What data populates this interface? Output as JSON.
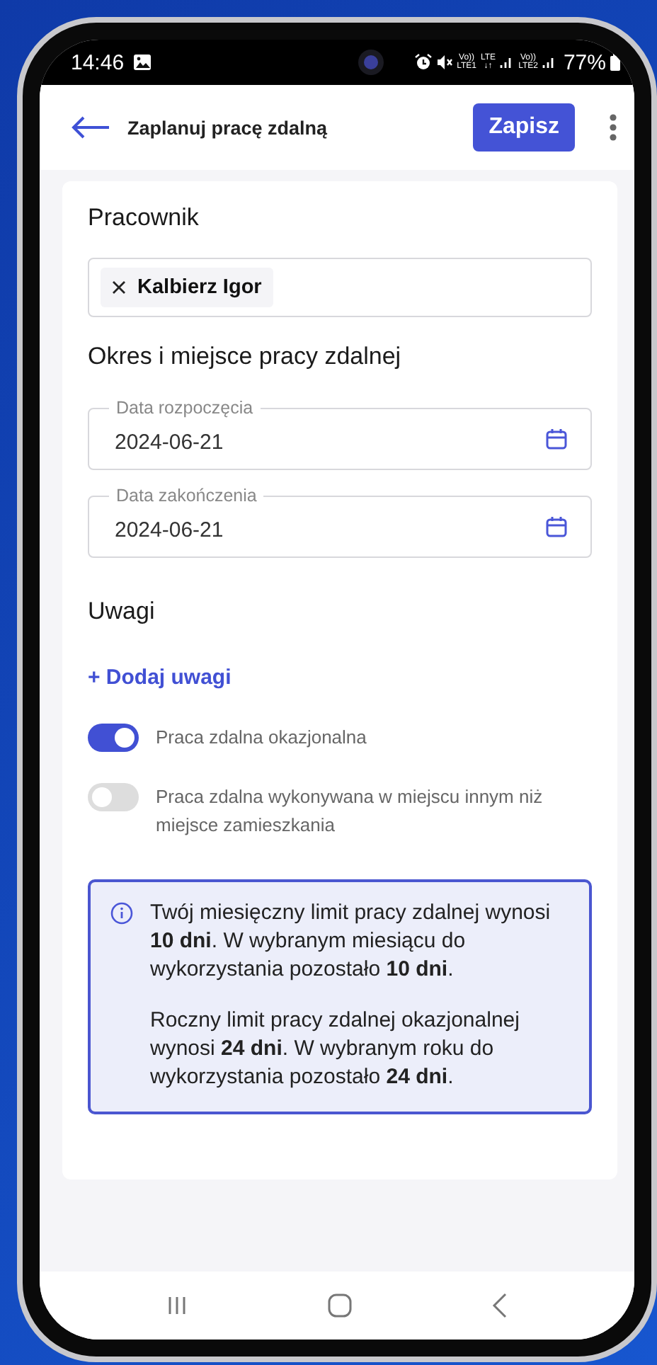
{
  "status_bar": {
    "time": "14:46",
    "network_labels": [
      {
        "top": "Vo))",
        "bottom": "LTE1"
      },
      {
        "top": "LTE",
        "bottom": "↓↑"
      },
      {
        "top": "Vo))",
        "bottom": "LTE2"
      }
    ],
    "battery": "77%"
  },
  "app_bar": {
    "title": "Zaplanuj pracę zdalną",
    "save_button": "Zapisz"
  },
  "form": {
    "employee_section": {
      "heading": "Pracownik",
      "chips": [
        {
          "label": "Kalbierz Igor"
        }
      ]
    },
    "period_section": {
      "heading": "Okres i miejsce pracy zdalnej",
      "fields": [
        {
          "label": "Data rozpoczęcia",
          "value": "2024-06-21"
        },
        {
          "label": "Data zakończenia",
          "value": "2024-06-21"
        }
      ]
    },
    "notes_section": {
      "heading": "Uwagi",
      "add_link": "+ Dodaj uwagi"
    },
    "toggles": [
      {
        "label": "Praca zdalna okazjonalna",
        "on": true
      },
      {
        "label": "Praca zdalna wykonywana w miejscu innym niż miejsce zamieszkania",
        "on": false
      }
    ],
    "info_box": {
      "paragraphs": [
        "Twój miesięczny limit pracy zdalnej wynosi **10 dni**. W wybranym miesiącu do wykorzystania pozostało **10 dni**.",
        "Roczny limit pracy zdalnej okazjonalnej wynosi **24 dni**. W wybranym roku do wykorzystania pozostało **24 dni**."
      ]
    }
  }
}
